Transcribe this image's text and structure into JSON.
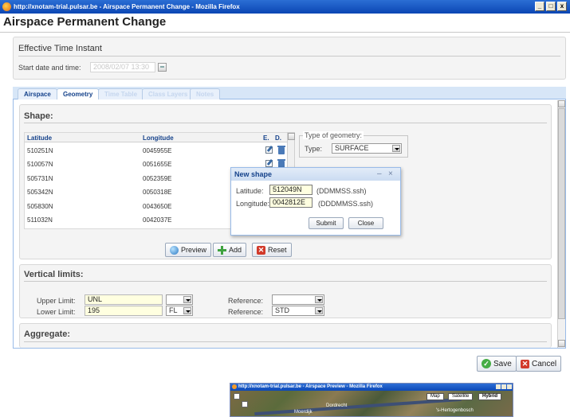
{
  "window": {
    "title": "http://xnotam-trial.pulsar.be - Airspace Permanent Change - Mozilla Firefox",
    "min_label": "_",
    "max_label": "□",
    "close_label": "x"
  },
  "app": {
    "title": "Airspace Permanent Change"
  },
  "effective": {
    "section_title": "Effective Time Instant",
    "start_label": "Start date and time:",
    "start_value": "2008/02/07 13:30"
  },
  "tabs": [
    {
      "label": "Airspace"
    },
    {
      "label": "Geometry"
    },
    {
      "label": "Time Table"
    },
    {
      "label": "Class Layers"
    },
    {
      "label": "Notes"
    }
  ],
  "shape": {
    "section_title": "Shape:",
    "columns": {
      "lat": "Latitude",
      "lon": "Longitude",
      "edit": "E.",
      "delete": "D."
    },
    "rows": [
      {
        "lat": "510251N",
        "lon": "0045955E"
      },
      {
        "lat": "510057N",
        "lon": "0051655E"
      },
      {
        "lat": "505731N",
        "lon": "0052359E"
      },
      {
        "lat": "505342N",
        "lon": "0050318E"
      },
      {
        "lat": "505830N",
        "lon": "0043650E"
      },
      {
        "lat": "511032N",
        "lon": "0042037E"
      }
    ],
    "geometry_legend": "Type of geometry:",
    "type_label": "Type:",
    "type_value": "SURFACE",
    "preview_label": "Preview",
    "add_label": "Add",
    "reset_label": "Reset"
  },
  "dialog": {
    "title": "New shape",
    "lat_label": "Latitude:",
    "lat_value": "512049N",
    "lat_hint": "(DDMMSS.ssh)",
    "lon_label": "Longitude:",
    "lon_value": "0042812E",
    "lon_hint": "(DDDMMSS.ssh)",
    "submit_label": "Submit",
    "close_label": "Close",
    "min_label": "–",
    "close_x": "×"
  },
  "vertical": {
    "section_title": "Vertical limits:",
    "upper_label": "Upper Limit:",
    "upper_value": "UNL",
    "upper_unit": "",
    "upper_ref_label": "Reference:",
    "upper_ref_value": "",
    "lower_label": "Lower Limit:",
    "lower_value": "195",
    "lower_unit": "FL",
    "lower_ref_label": "Reference:",
    "lower_ref_value": "STD"
  },
  "aggregate": {
    "section_title": "Aggregate:"
  },
  "footer": {
    "save_label": "Save",
    "cancel_label": "Cancel"
  },
  "preview_window": {
    "title": "http://xnotam-trial.pulsar.be - Airspace Preview - Mozilla Firefox",
    "map_label": "Map",
    "satellite_label": "Satellite",
    "hybrid_label": "Hybrid",
    "places": [
      "Moerdijk",
      "Dordrecht",
      "'s-Hertogenbosch"
    ]
  }
}
